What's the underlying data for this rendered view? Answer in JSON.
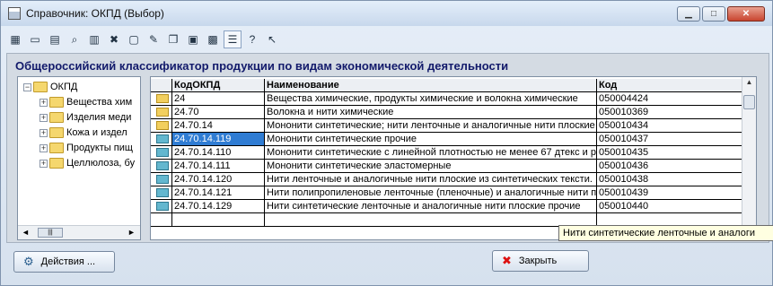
{
  "window": {
    "title": "Справочник: ОКПД (Выбор)",
    "min_icon": "▁",
    "max_icon": "□",
    "close_icon": "✕"
  },
  "toolbar": {
    "icons": [
      "new-icon",
      "open-icon",
      "edit-icon",
      "search-icon",
      "table-icon",
      "delete-icon",
      "copy-icon",
      "tools-icon",
      "clipboard-icon",
      "document-icon",
      "export-icon",
      "tree-view-icon",
      "help-icon",
      "whats-this-icon"
    ]
  },
  "heading": "Общероссийский классификатор продукции по видам экономической деятельности",
  "tree": {
    "root": "ОКПД",
    "items": [
      "Вещества хим",
      "Изделия меди",
      "Кожа и издел",
      "Продукты пищ",
      "Целлюлоза, бу"
    ],
    "scroll_left": "◄",
    "scroll_right": "►",
    "scroll_thumb": "|||"
  },
  "grid": {
    "columns": [
      "КодОКПД",
      "Наименование",
      "Код"
    ],
    "rows": [
      {
        "type": "folder",
        "code": "24",
        "name": "Вещества химические, продукты химические и волокна химические",
        "id": "050004424"
      },
      {
        "type": "folder",
        "code": "24.70",
        "name": "Волокна и нити химические",
        "id": "050010369"
      },
      {
        "type": "folder",
        "code": "24.70.14",
        "name": "Мононити синтетические; нити ленточные и аналогичные нити плоские",
        "id": "050010434"
      },
      {
        "type": "item",
        "code": "24.70.14.119",
        "name": "Мононити синтетические прочие",
        "id": "050010437",
        "selected": true
      },
      {
        "type": "item",
        "code": "24.70.14.110",
        "name": "Мононити синтетические с линейной плотностью не менее 67 дтекс и р",
        "id": "050010435"
      },
      {
        "type": "item",
        "code": "24.70.14.111",
        "name": "Мононити синтетические эластомерные",
        "id": "050010436"
      },
      {
        "type": "item",
        "code": "24.70.14.120",
        "name": "Нити ленточные и аналогичные нити плоские из синтетических тексти.",
        "id": "050010438"
      },
      {
        "type": "item",
        "code": "24.70.14.121",
        "name": "Нити полипропиленовые ленточные (пленочные) и аналогичные нити п.",
        "id": "050010439"
      },
      {
        "type": "item",
        "code": "24.70.14.129",
        "name": "Нити синтетические ленточные и аналогичные нити плоские прочие",
        "id": "050010440"
      }
    ],
    "scroll_up": "▲",
    "scroll_down": "▼"
  },
  "tooltip": "Нити синтетические ленточные и аналоги",
  "buttons": {
    "actions": "Действия ...",
    "close": "Закрыть"
  },
  "colors": {
    "selection": "#2f7cd3",
    "heading": "#121a6b",
    "tooltip_bg": "#ffffe1"
  }
}
